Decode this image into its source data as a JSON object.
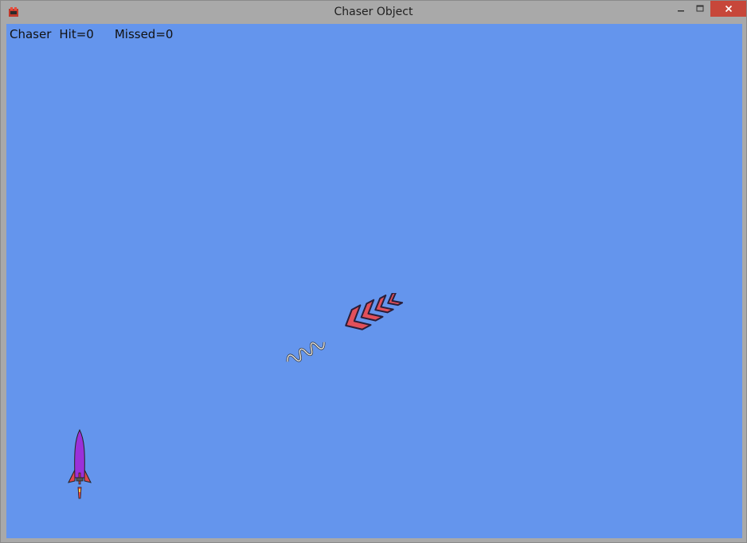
{
  "window": {
    "title": "Chaser Object",
    "icon": "game-app-icon",
    "controls": {
      "minimize": "minimize-icon",
      "maximize": "maximize-icon",
      "close": "close-icon"
    }
  },
  "colors": {
    "background": "#6495ed",
    "titlebar": "#a9a9a9",
    "close_button": "#c7473a"
  },
  "hud": {
    "mode": "Chaser",
    "hit_text": "Hit=0",
    "missed_text": "Missed=0"
  },
  "sprites": {
    "chaser": "red-chevron-chaser-icon",
    "projectile": "spring-trail-icon",
    "player": "purple-rocket-icon"
  }
}
